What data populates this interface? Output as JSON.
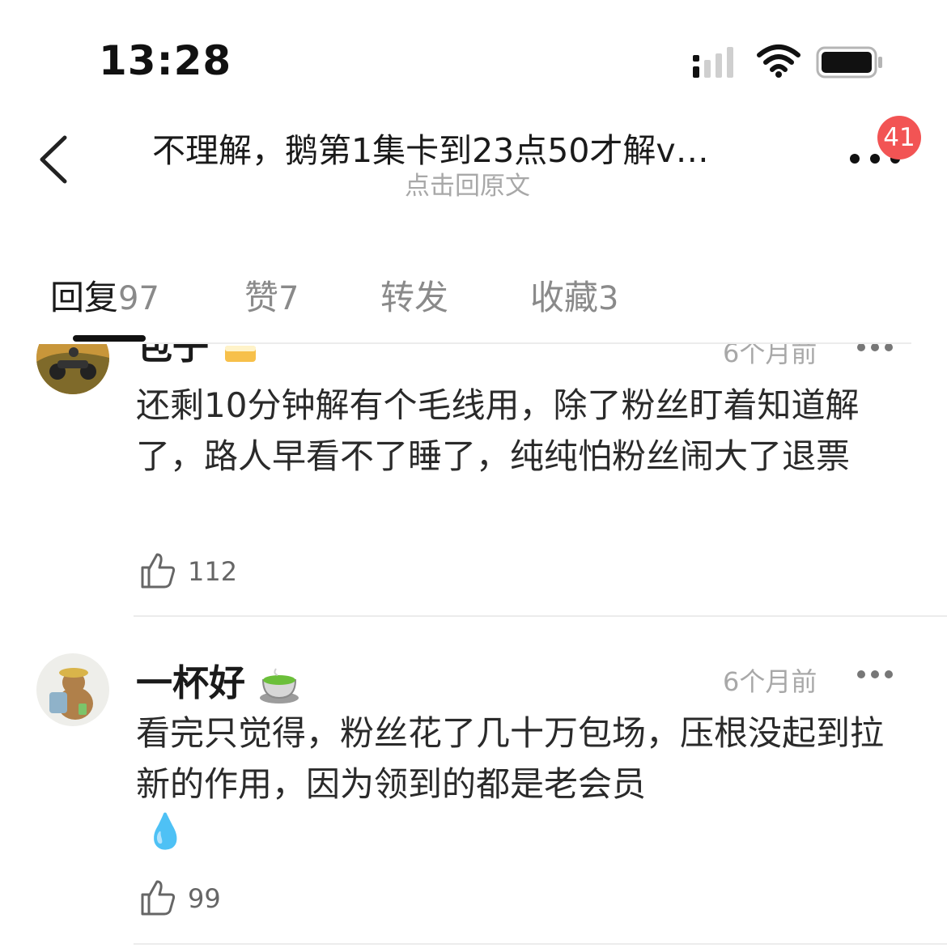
{
  "status_bar": {
    "time": "13:28"
  },
  "nav": {
    "title": "不理解，鹅第1集卡到23点50才解v…",
    "subtitle": "点击回原文",
    "notification_count": "41"
  },
  "tabs": [
    {
      "label": "回复",
      "count": "97"
    },
    {
      "label": "赞",
      "count": "7"
    },
    {
      "label": "转发",
      "count": ""
    },
    {
      "label": "收藏",
      "count": "3"
    }
  ],
  "comments": [
    {
      "username": "包子",
      "time": "6个月前",
      "text": "还剩10分钟解有个毛线用，除了粉丝盯着知道解了，路人早看不了睡了，纯纯怕粉丝闹大了退票",
      "likes": "112"
    },
    {
      "username": "一杯好",
      "time": "6个月前",
      "text": "看完只觉得，粉丝花了几十万包场，压根没起到拉新的作用，因为领到的都是老会员",
      "emoji": "💧",
      "likes": "99"
    }
  ],
  "colors": {
    "badge": "#f25454",
    "muted_text": "#a8a8a8",
    "active_tab": "#1a1a1a"
  }
}
